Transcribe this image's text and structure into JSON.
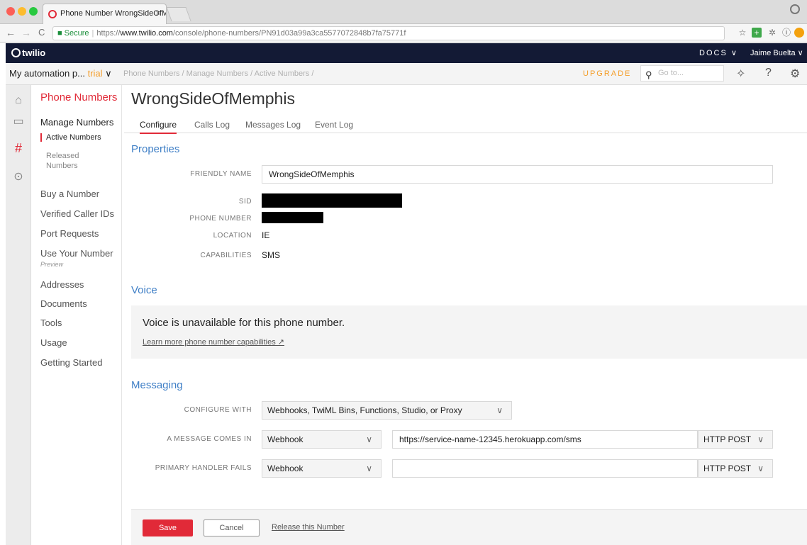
{
  "browser": {
    "tab_title": "Phone Number WrongSideOfM",
    "tab_close": "×",
    "nav": {
      "back": "←",
      "forward": "→",
      "reload": "C"
    },
    "url": {
      "secure_label": "Secure",
      "scheme": "https://",
      "host": "www.twilio.com",
      "path": "/console/phone-numbers/PN91d03a99a3ca5577072848b7fa75771f"
    },
    "icons": {
      "star": "☆",
      "info": "ⓘ"
    }
  },
  "header": {
    "logo_text": "twilio",
    "docs_label": "DOCS ∨",
    "user_label": "Jaime Buelta ∨"
  },
  "subheader": {
    "account_name": "My automation p...",
    "account_badge": "trial",
    "account_chevron": "∨",
    "breadcrumbs": "Phone Numbers  /  Manage Numbers  /  Active Numbers  /",
    "upgrade_label": "UPGRADE",
    "search_placeholder": "Go to...",
    "help_icon": "?"
  },
  "sidebar": {
    "title": "Phone Numbers",
    "group_label": "Manage Numbers",
    "sub_active": "Active Numbers",
    "sub_inactive": "Released Numbers",
    "items": [
      "Buy a Number",
      "Verified Caller IDs",
      "Port Requests",
      "Use Your Number",
      "Addresses",
      "Documents",
      "Tools",
      "Usage",
      "Getting Started"
    ],
    "preview_badge": "Preview"
  },
  "main": {
    "title": "WrongSideOfMemphis",
    "tabs": [
      "Configure",
      "Calls Log",
      "Messages Log",
      "Event Log"
    ],
    "properties": {
      "heading": "Properties",
      "friendly_name_label": "FRIENDLY NAME",
      "friendly_name_value": "WrongSideOfMemphis",
      "sid_label": "SID",
      "phone_label": "PHONE NUMBER",
      "location_label": "LOCATION",
      "location_value": "IE",
      "capabilities_label": "CAPABILITIES",
      "capabilities_value": "SMS"
    },
    "voice": {
      "heading": "Voice",
      "message": "Voice is unavailable for this phone number.",
      "link": "Learn more phone number capabilities ↗"
    },
    "messaging": {
      "heading": "Messaging",
      "configure_label": "CONFIGURE WITH",
      "configure_value": "Webhooks, TwiML Bins, Functions, Studio, or Proxy",
      "incoming_label": "A MESSAGE COMES IN",
      "incoming_type": "Webhook",
      "incoming_url": "https://service-name-12345.herokuapp.com/sms",
      "incoming_method": "HTTP POST",
      "fail_label": "PRIMARY HANDLER FAILS",
      "fail_type": "Webhook",
      "fail_url": "",
      "fail_method": "HTTP POST",
      "chevron": "∨"
    }
  },
  "footer": {
    "save_label": "Save",
    "cancel_label": "Cancel",
    "release_label": "Release this Number"
  },
  "colors": {
    "brand_red": "#e12a38",
    "nav_dark": "#131a35",
    "link_blue": "#3f7fc6",
    "upgrade_orange": "#f49e2a"
  }
}
